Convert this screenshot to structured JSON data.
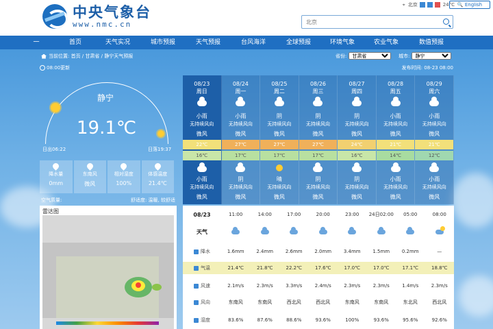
{
  "header": {
    "logo_cn": "中央气象台",
    "logo_url": "www.nmc.cn",
    "util_text": "北京",
    "util_temp": "24°C",
    "english_label": "English",
    "search_placeholder": "北京"
  },
  "nav": {
    "items": [
      "一",
      "首页",
      "天气实况",
      "城市预报",
      "天气预报",
      "台风海洋",
      "全球预报",
      "环境气象",
      "农业气象",
      "数值预报"
    ]
  },
  "breadcrumb": {
    "text": "当前位置: 首页 / 甘肃省 / 静宁天气预报"
  },
  "selectors": {
    "province_label": "省份:",
    "province_value": "甘肃省",
    "city_label": "城市:",
    "city_value": "静宁"
  },
  "update": {
    "time_label": "08:00更新",
    "publish": "发布时间: 08-23 08:00"
  },
  "current": {
    "station": "静宁",
    "temperature": "19.1℃",
    "sunrise": "日出06:22",
    "sunset": "日落19:37",
    "stats": [
      {
        "label": "降水量",
        "value": "0mm",
        "icon": "raindrop-icon"
      },
      {
        "label": "东南风",
        "value": "微风",
        "icon": "wind-icon"
      },
      {
        "label": "相对湿度",
        "value": "100%",
        "icon": "humidity-icon"
      },
      {
        "label": "体感温度",
        "value": "21.4℃",
        "icon": "thermometer-icon"
      }
    ],
    "aq_left": "空气质量:",
    "aq_right": "舒适度: 温暖, 较舒适"
  },
  "radar": {
    "title": "雷达图"
  },
  "forecast": {
    "days": [
      {
        "date": "08/23",
        "week": "周日",
        "day_weather": "小雨",
        "day_wind": "无持续风向",
        "day_level": "微风",
        "high": "22℃",
        "low": "16℃",
        "night_weather": "小雨",
        "night_wind": "无持续风向",
        "night_level": "微风",
        "day_icon": "cloud-icon",
        "night_icon": "cloud-icon"
      },
      {
        "date": "08/24",
        "week": "周一",
        "day_weather": "小雨",
        "day_wind": "无持续风向",
        "day_level": "微风",
        "high": "27℃",
        "low": "17℃",
        "night_weather": "阴",
        "night_wind": "无持续风向",
        "night_level": "微风",
        "day_icon": "cloud-icon",
        "night_icon": "cloud-icon"
      },
      {
        "date": "08/25",
        "week": "周二",
        "day_weather": "阴",
        "day_wind": "无持续风向",
        "day_level": "微风",
        "high": "27℃",
        "low": "17℃",
        "night_weather": "晴",
        "night_wind": "无持续风向",
        "night_level": "微风",
        "day_icon": "cloud-icon",
        "night_icon": "sun-icon"
      },
      {
        "date": "08/26",
        "week": "周三",
        "day_weather": "阴",
        "day_wind": "无持续风向",
        "day_level": "微风",
        "high": "27℃",
        "low": "17℃",
        "night_weather": "阴",
        "night_wind": "无持续风向",
        "night_level": "微风",
        "day_icon": "cloud-icon",
        "night_icon": "cloud-icon"
      },
      {
        "date": "08/27",
        "week": "周四",
        "day_weather": "阴",
        "day_wind": "无持续风向",
        "day_level": "微风",
        "high": "24℃",
        "low": "16℃",
        "night_weather": "阴",
        "night_wind": "无持续风向",
        "night_level": "微风",
        "day_icon": "cloud-icon",
        "night_icon": "cloud-icon"
      },
      {
        "date": "08/28",
        "week": "周五",
        "day_weather": "小雨",
        "day_wind": "无持续风向",
        "day_level": "微风",
        "high": "21℃",
        "low": "14℃",
        "night_weather": "小雨",
        "night_wind": "无持续风向",
        "night_level": "微风",
        "day_icon": "cloud-icon",
        "night_icon": "cloud-icon"
      },
      {
        "date": "08/29",
        "week": "周六",
        "day_weather": "小雨",
        "day_wind": "无持续风向",
        "day_level": "微风",
        "high": "21℃",
        "low": "12℃",
        "night_weather": "小雨",
        "night_wind": "无持续风向",
        "night_level": "微风",
        "day_icon": "cloud-icon",
        "night_icon": "cloud-icon"
      }
    ],
    "high_colors": [
      "#f2e07a",
      "#f0b05a",
      "#f0b05a",
      "#f0b05a",
      "#f2d070",
      "#f2e07a",
      "#f2e07a"
    ],
    "low_colors": [
      "#c8e6a8",
      "#b8e0a0",
      "#b8e0a0",
      "#b8e0a0",
      "#c8e6a8",
      "#a8dca0",
      "#a0d8b0"
    ]
  },
  "hourly": {
    "date": "08/23",
    "times": [
      "11:00",
      "14:00",
      "17:00",
      "20:00",
      "23:00",
      "24日02:00",
      "05:00",
      "08:00"
    ],
    "weather_label": "天气",
    "rows": [
      {
        "label": "降水",
        "icon": "precip-icon",
        "values": [
          "1.6mm",
          "2.4mm",
          "2.6mm",
          "2.0mm",
          "3.4mm",
          "1.5mm",
          "0.2mm",
          "—"
        ]
      },
      {
        "label": "气温",
        "icon": "temp-icon",
        "values": [
          "21.4℃",
          "21.8℃",
          "22.2℃",
          "17.6℃",
          "17.0℃",
          "17.0℃",
          "17.1℃",
          "18.8℃"
        ]
      },
      {
        "label": "风速",
        "icon": "windspeed-icon",
        "values": [
          "2.1m/s",
          "2.3m/s",
          "3.3m/s",
          "2.4m/s",
          "2.3m/s",
          "2.3m/s",
          "1.4m/s",
          "2.3m/s"
        ]
      },
      {
        "label": "风向",
        "icon": "winddir-icon",
        "values": [
          "东南风",
          "东南风",
          "西北风",
          "西北风",
          "东南风",
          "东南风",
          "东北风",
          "西北风"
        ]
      },
      {
        "label": "湿度",
        "icon": "humid-icon",
        "values": [
          "83.6%",
          "87.6%",
          "88.6%",
          "93.6%",
          "100%",
          "93.6%",
          "95.6%",
          "92.6%"
        ]
      }
    ],
    "weather_icons": [
      "rain-icon",
      "rain-icon",
      "rain-icon",
      "rain-icon",
      "rain-icon",
      "rain-icon",
      "rain-icon",
      "partly-cloudy-icon"
    ],
    "temp_highlight": "#f3f0b8"
  }
}
